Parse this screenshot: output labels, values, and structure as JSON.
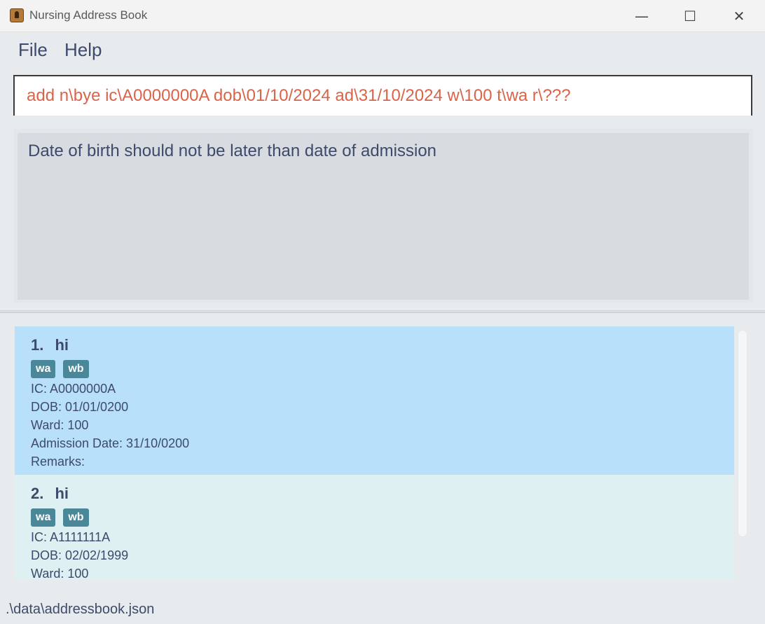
{
  "window": {
    "title": "Nursing Address Book",
    "minimize_glyph": "—",
    "maximize_glyph": "☐",
    "close_glyph": "✕"
  },
  "menu": {
    "file": "File",
    "help": "Help"
  },
  "command": {
    "value": "add n\\bye ic\\A0000000A dob\\01/10/2024 ad\\31/10/2024 w\\100 t\\wa r\\???",
    "text_color": "#d9644a"
  },
  "result": {
    "message": "Date of birth should not be later than date of admission"
  },
  "patients": [
    {
      "index": "1.",
      "name": "hi",
      "tags": [
        "wa",
        "wb"
      ],
      "ic": "IC: A0000000A",
      "dob": "DOB: 01/01/0200",
      "ward": "Ward: 100",
      "admission": "Admission Date: 31/10/0200",
      "remarks": "Remarks:"
    },
    {
      "index": "2.",
      "name": "hi",
      "tags": [
        "wa",
        "wb"
      ],
      "ic": "IC: A1111111A",
      "dob": "DOB: 02/02/1999",
      "ward": "Ward: 100"
    }
  ],
  "status": {
    "file_path": ".\\data\\addressbook.json"
  },
  "colors": {
    "selected_card": "#b9e0fb",
    "card": "#dff0f3",
    "tag": "#4a8799"
  }
}
